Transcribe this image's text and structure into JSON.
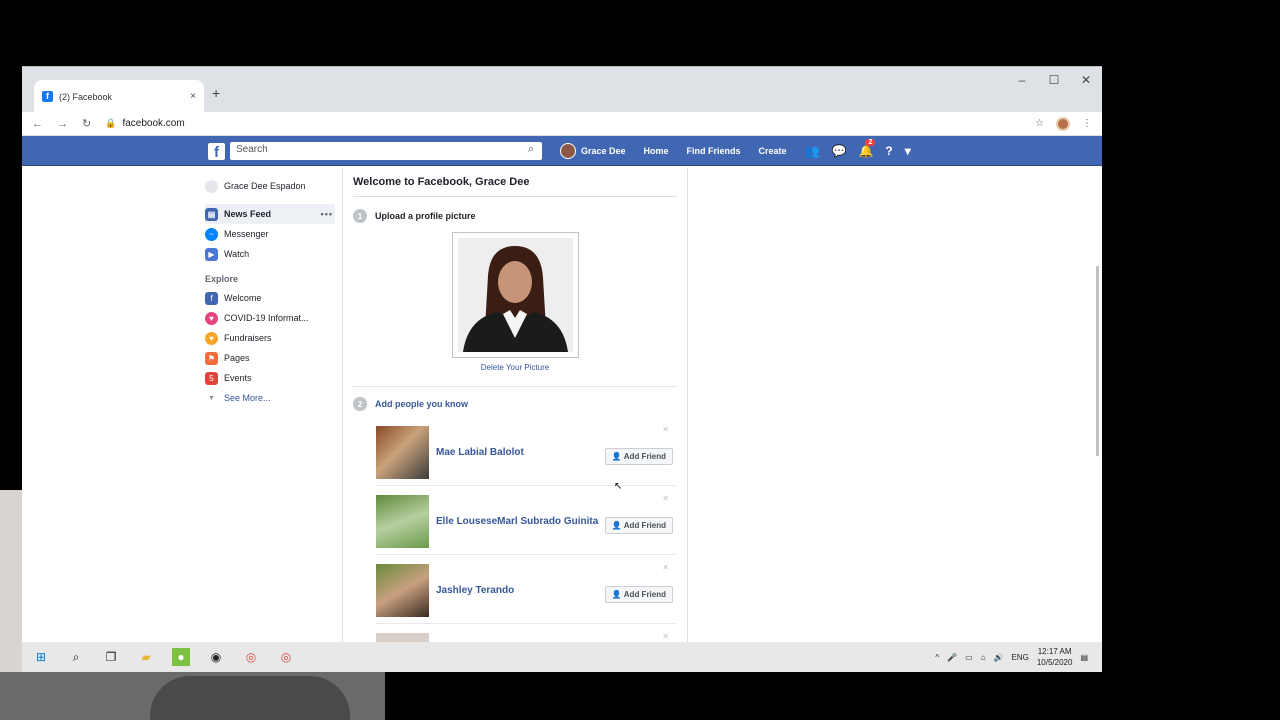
{
  "browser": {
    "tab_title": "(2) Facebook",
    "url": "facebook.com",
    "new_tab": "+",
    "tab_close": "×"
  },
  "fb": {
    "logo": "f",
    "search_placeholder": "Search",
    "user_name": "Grace Dee",
    "nav": [
      "Home",
      "Find Friends",
      "Create"
    ],
    "notif_count": "2"
  },
  "sidebar": {
    "profile": "Grace Dee Espadon",
    "items": [
      "News Feed",
      "Messenger",
      "Watch"
    ],
    "explore_label": "Explore",
    "explore": [
      "Welcome",
      "COVID-19 Informat...",
      "Fundraisers",
      "Pages",
      "Events"
    ],
    "see_more": "See More...",
    "dots": "•••"
  },
  "main": {
    "welcome": "Welcome to Facebook, Grace Dee",
    "step1": {
      "num": "1",
      "label": "Upload a profile picture"
    },
    "delete_picture": "Delete Your Picture",
    "step2": {
      "num": "2",
      "label": "Add people you know"
    },
    "people": [
      {
        "name": "Mae Labial Balolot",
        "button": "Add Friend"
      },
      {
        "name": "Elle LouseseMarl Subrado Guinita",
        "button": "Add Friend"
      },
      {
        "name": "Jashley Terando",
        "button": "Add Friend"
      }
    ]
  },
  "taskbar": {
    "lang": "ENG",
    "time": "12:17 AM",
    "date": "10/5/2020"
  },
  "colors": {
    "fb_blue": "#4267b2",
    "link_blue": "#365899"
  }
}
